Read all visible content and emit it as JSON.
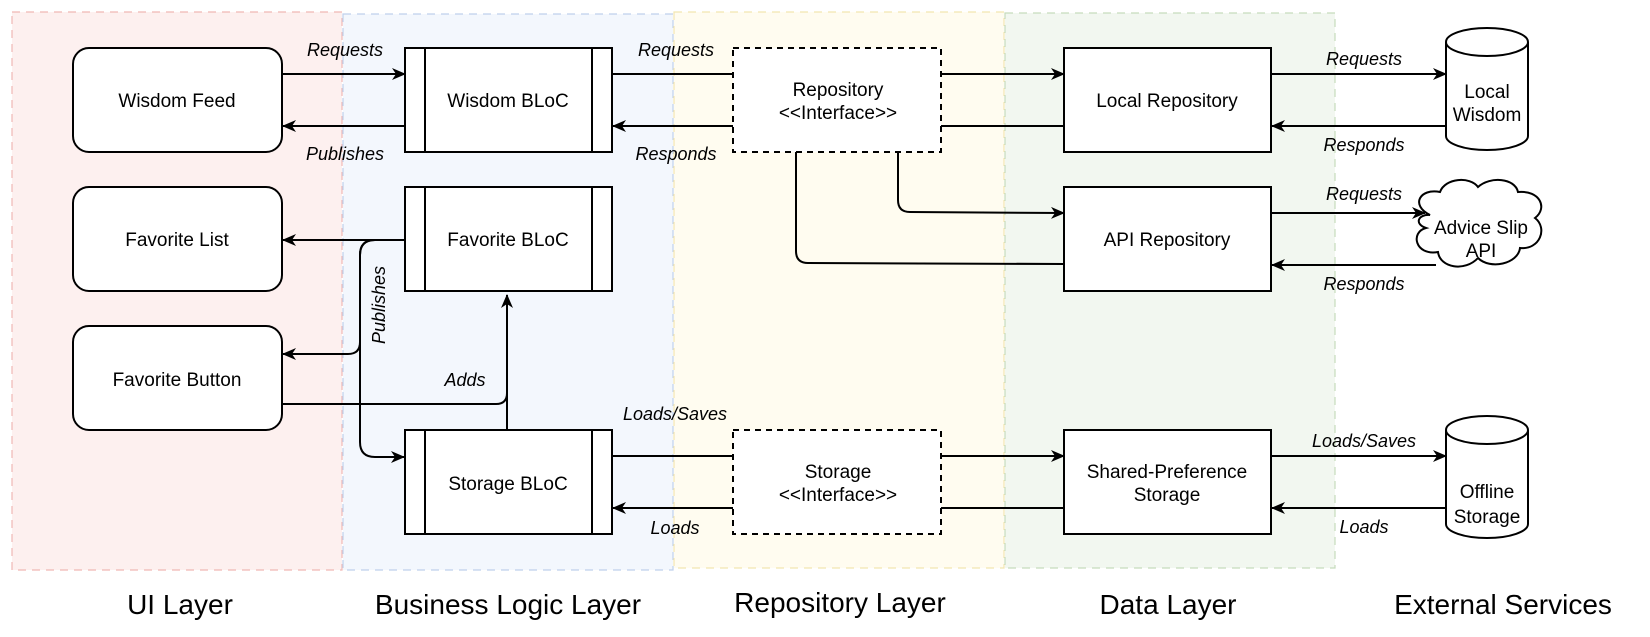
{
  "layers": [
    {
      "id": "ui",
      "label": "UI Layer",
      "fill": "#fdf0ef",
      "stroke": "#f0b8b4"
    },
    {
      "id": "business",
      "label": "Business Logic Layer",
      "fill": "#f3f7fd",
      "stroke": "#bfd0ec"
    },
    {
      "id": "repository",
      "label": "Repository Layer",
      "fill": "#fffcf0",
      "stroke": "#f2e6b0"
    },
    {
      "id": "data",
      "label": "Data Layer",
      "fill": "#f2f7f0",
      "stroke": "#c6dcbc"
    },
    {
      "id": "external",
      "label": "External Services"
    }
  ],
  "nodes": {
    "wisdom_feed": "Wisdom Feed",
    "favorite_list": "Favorite List",
    "favorite_button": "Favorite Button",
    "wisdom_bloc": "Wisdom BLoC",
    "favorite_bloc": "Favorite BLoC",
    "storage_bloc": "Storage BLoC",
    "repository_interface": [
      "Repository",
      "<<Interface>>"
    ],
    "storage_interface": [
      "Storage",
      "<<Interface>>"
    ],
    "local_repository": "Local Repository",
    "api_repository": "API Repository",
    "shared_pref_storage": [
      "Shared-Preference",
      "Storage"
    ],
    "local_wisdom": [
      "Local",
      "Wisdom"
    ],
    "advice_slip_api": [
      "Advice Slip",
      "API"
    ],
    "offline_storage": [
      "Offline",
      "Storage"
    ]
  },
  "edges": {
    "feed_requests": "Requests",
    "feed_publishes": "Publishes",
    "bloc_requests": "Requests",
    "bloc_responds": "Responds",
    "fav_publishes": "Publishes",
    "fav_adds": "Adds",
    "storage_loads_saves": "Loads/Saves",
    "storage_loads": "Loads",
    "local_requests": "Requests",
    "local_responds": "Responds",
    "api_requests": "Requests",
    "api_responds": "Responds",
    "offline_loads_saves": "Loads/Saves",
    "offline_loads": "Loads"
  }
}
